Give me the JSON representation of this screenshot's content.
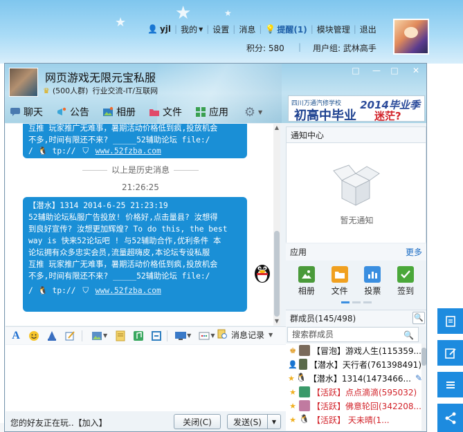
{
  "forum": {
    "user": "yjl",
    "nav": [
      "我的",
      "设置",
      "消息"
    ],
    "remind": "提醒(1)",
    "nav_tail": [
      "模块管理",
      "退出"
    ],
    "points_label": "积分:",
    "points_value": "580",
    "group_label": "用户组:",
    "group_value": "武林高手"
  },
  "window": {
    "group_name": "网页游戏无限元宝私服",
    "group_members": "(500人群)",
    "group_category": "行业交流-IT/互联网",
    "controls": [
      "□",
      "—",
      "□",
      "✕"
    ]
  },
  "ad": {
    "school": "四川万通汽修学校",
    "year": "2014毕业季",
    "main": "初高中毕业",
    "tail": "迷茫?"
  },
  "toolbar": {
    "items": [
      {
        "label": "聊天",
        "icon": "chat-icon"
      },
      {
        "label": "公告",
        "icon": "announcement-icon"
      },
      {
        "label": "相册",
        "icon": "album-icon"
      },
      {
        "label": "文件",
        "icon": "folder-icon"
      },
      {
        "label": "应用",
        "icon": "apps-icon"
      }
    ]
  },
  "chat": {
    "top_bubble_lines": [
      "互推 玩家推广无难事，暑期活动价格低到疯,投放机会",
      "不多,时间有限还不来? _____52辅助论坛   file:/"
    ],
    "top_bubble_link_prefix": "/",
    "top_bubble_link_mid": "tp://",
    "top_bubble_url": "www.52fzba.com",
    "history_label": "以上是历史消息",
    "time": "21:26:25",
    "message_header": "【潜水】1314 2014-6-25 21:23:19",
    "message_lines": [
      "52辅助论坛私服广告投放! 价格好,点击量县? 汝想得",
      "到良好宣传? 汝想更加辉煌? To do this, the best",
      "way is 快来52论坛吧 ! 与52辅助合作,优利条件 本",
      "论坛拥有众多忠实会员,流量超嗨皮,本论坛专设私服",
      "互推 玩家推广无难事，暑期活动价格低到疯,投放机会",
      "不多,时间有限还不来? _____52辅助论坛   file:/"
    ],
    "link_prefix": "/",
    "link_mid": "tp://",
    "url": "www.52fzba.com"
  },
  "input": {
    "message_record": "消息记录",
    "friend_notice": "您的好友正在玩..【加入】",
    "close_label": "关闭(C)",
    "send_label": "发送(S)"
  },
  "notice": {
    "title": "通知中心",
    "empty": "暂无通知"
  },
  "apps": {
    "title": "应用",
    "more": "更多",
    "items": [
      {
        "label": "相册",
        "color": "#4a9a3a"
      },
      {
        "label": "文件",
        "color": "#f0a020"
      },
      {
        "label": "投票",
        "color": "#3a8ee0"
      },
      {
        "label": "签到",
        "color": "#4aa83a"
      }
    ]
  },
  "members": {
    "title": "群成员(145/498)",
    "search_placeholder": "搜索群成员",
    "list": [
      {
        "text": "【冒泡】游戏人生(115359...",
        "red": false,
        "color": "#7a6a5a"
      },
      {
        "text": "【潜水】天行者(761398491)",
        "red": false,
        "color": "#5a6a4a"
      },
      {
        "text": "【潜水】1314(1473466...",
        "red": false,
        "color": "#222222"
      },
      {
        "text": "【活跃】点点滴滴(595032)",
        "red": true,
        "color": "#3a9a6a"
      },
      {
        "text": "【活跃】佛意轮回(342208...",
        "red": true,
        "color": "#c07aa0"
      },
      {
        "text": "【活跃】       天未晴(1...",
        "red": true,
        "color": "#222222"
      }
    ]
  }
}
